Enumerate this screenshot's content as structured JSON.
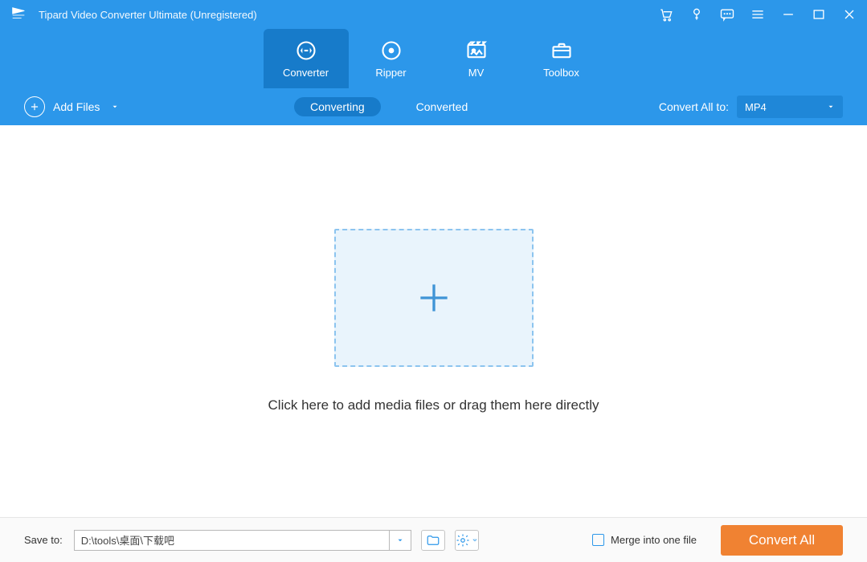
{
  "title": "Tipard Video Converter Ultimate (Unregistered)",
  "nav": {
    "converter": "Converter",
    "ripper": "Ripper",
    "mv": "MV",
    "toolbox": "Toolbox"
  },
  "subbar": {
    "add_files": "Add Files",
    "converting": "Converting",
    "converted": "Converted",
    "convert_all_to_label": "Convert All to:",
    "format": "MP4"
  },
  "main": {
    "drop_text": "Click here to add media files or drag them here directly"
  },
  "bottom": {
    "save_to_label": "Save to:",
    "save_path": "D:\\tools\\桌面\\下载吧",
    "merge_label": "Merge into one file",
    "convert_all": "Convert All"
  }
}
